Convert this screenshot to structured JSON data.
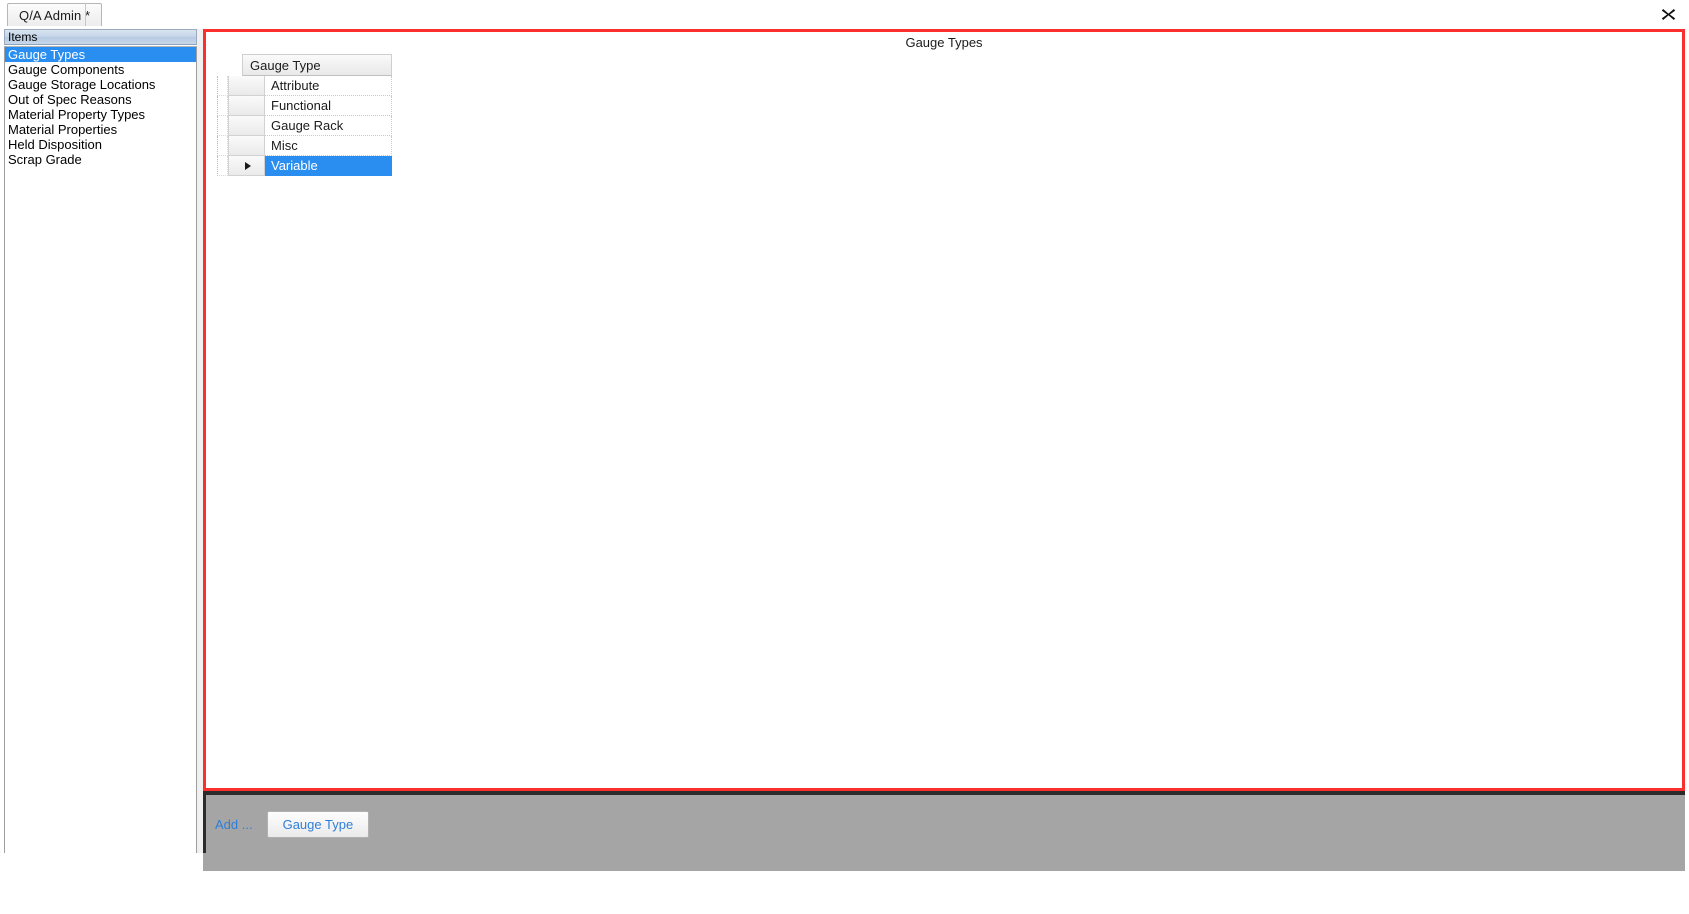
{
  "window": {
    "close_icon": "close-x-icon"
  },
  "tabs": [
    {
      "label": "Q/A Admin *",
      "active": true
    }
  ],
  "sidebar": {
    "header": "Items",
    "items": [
      {
        "label": "Gauge Types",
        "selected": true
      },
      {
        "label": "Gauge Components",
        "selected": false
      },
      {
        "label": "Gauge Storage Locations",
        "selected": false
      },
      {
        "label": "Out of Spec Reasons",
        "selected": false
      },
      {
        "label": "Material Property Types",
        "selected": false
      },
      {
        "label": "Material Properties",
        "selected": false
      },
      {
        "label": "Held Disposition",
        "selected": false
      },
      {
        "label": "Scrap Grade",
        "selected": false
      }
    ]
  },
  "main": {
    "title": "Gauge Types",
    "grid": {
      "columns": [
        "Gauge Type"
      ],
      "rows": [
        {
          "gauge_type": "Attribute",
          "selected": false
        },
        {
          "gauge_type": "Functional",
          "selected": false
        },
        {
          "gauge_type": "Gauge Rack",
          "selected": false
        },
        {
          "gauge_type": "Misc",
          "selected": false
        },
        {
          "gauge_type": "Variable",
          "selected": true
        }
      ]
    }
  },
  "toolbar": {
    "add_label": "Add ...",
    "add_gauge_type_button": "Gauge Type"
  },
  "colors": {
    "selection_blue": "#2a8ef0",
    "panel_highlight_red": "#fc2f2f",
    "toolbar_gray": "#a5a5a5",
    "link_blue": "#2f7fd8"
  }
}
